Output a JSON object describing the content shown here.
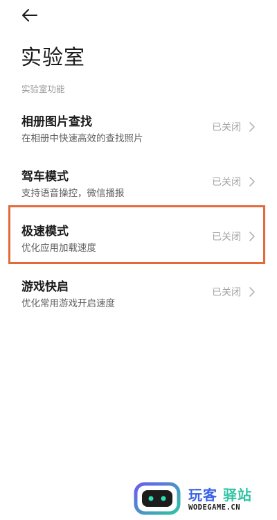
{
  "header": {
    "back_icon": "arrow-left-icon",
    "title": "实验室"
  },
  "section": {
    "label": "实验室功能"
  },
  "items": [
    {
      "title": "相册图片查找",
      "description": "在相册中快速高效的查找照片",
      "status": "已关闭"
    },
    {
      "title": "驾车模式",
      "description": "支持语音操控，微信播报",
      "status": "已关闭"
    },
    {
      "title": "极速模式",
      "description": "优化应用加载速度",
      "status": "已关闭"
    },
    {
      "title": "游戏快启",
      "description": "优化常用游戏开启速度",
      "status": "已关闭"
    }
  ],
  "highlight": {
    "color": "#e46a3c"
  },
  "watermark": {
    "brand_primary": "玩客",
    "brand_secondary": "驿站",
    "domain": "WODEGAME.CN"
  },
  "colors": {
    "text_primary": "#1b1b1b",
    "text_secondary": "#606060",
    "text_muted": "#a3a3a3",
    "watermark_blue": "#3a62e6",
    "watermark_teal": "#2fc3a4"
  }
}
